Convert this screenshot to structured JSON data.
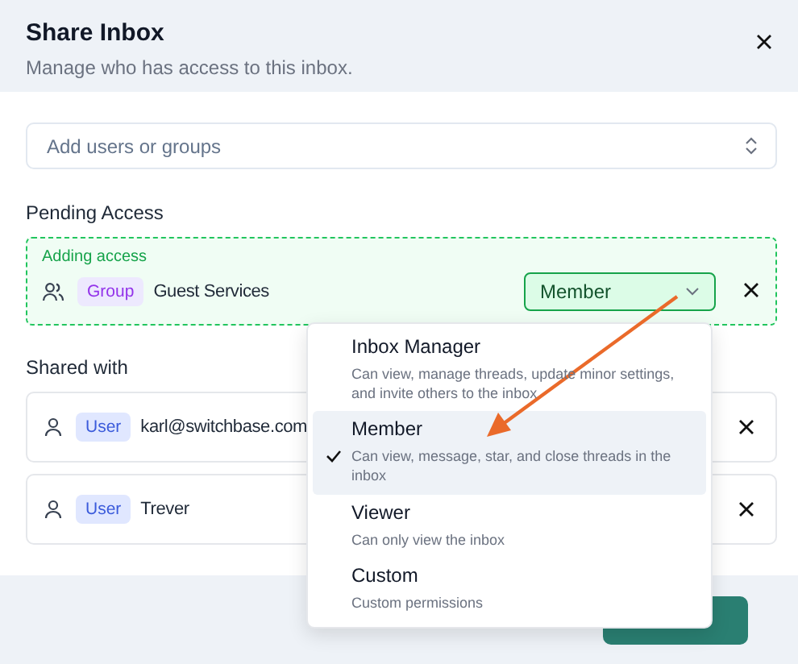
{
  "dialog": {
    "title": "Share Inbox",
    "subtitle": "Manage who has access to this inbox."
  },
  "search": {
    "placeholder": "Add users or groups"
  },
  "pending": {
    "heading": "Pending Access",
    "note": "Adding access",
    "entries": [
      {
        "kind": "group",
        "badge": "Group",
        "name": "Guest Services",
        "role": "Member"
      }
    ]
  },
  "shared": {
    "heading": "Shared with",
    "entries": [
      {
        "kind": "user",
        "badge": "User",
        "name": "karl@switchbase.com"
      },
      {
        "kind": "user",
        "badge": "User",
        "name": "Trever"
      }
    ]
  },
  "role_menu": {
    "items": [
      {
        "name": "Inbox Manager",
        "description": "Can view, manage threads, update minor settings, and invite others to the inbox",
        "selected": false
      },
      {
        "name": "Member",
        "description": "Can view, message, star, and close threads in the inbox",
        "selected": true
      },
      {
        "name": "Viewer",
        "description": "Can only view the inbox",
        "selected": false
      },
      {
        "name": "Custom",
        "description": "Custom permissions",
        "selected": false
      }
    ]
  },
  "footer": {
    "buttons": [
      {
        "kind": "primary"
      }
    ]
  }
}
